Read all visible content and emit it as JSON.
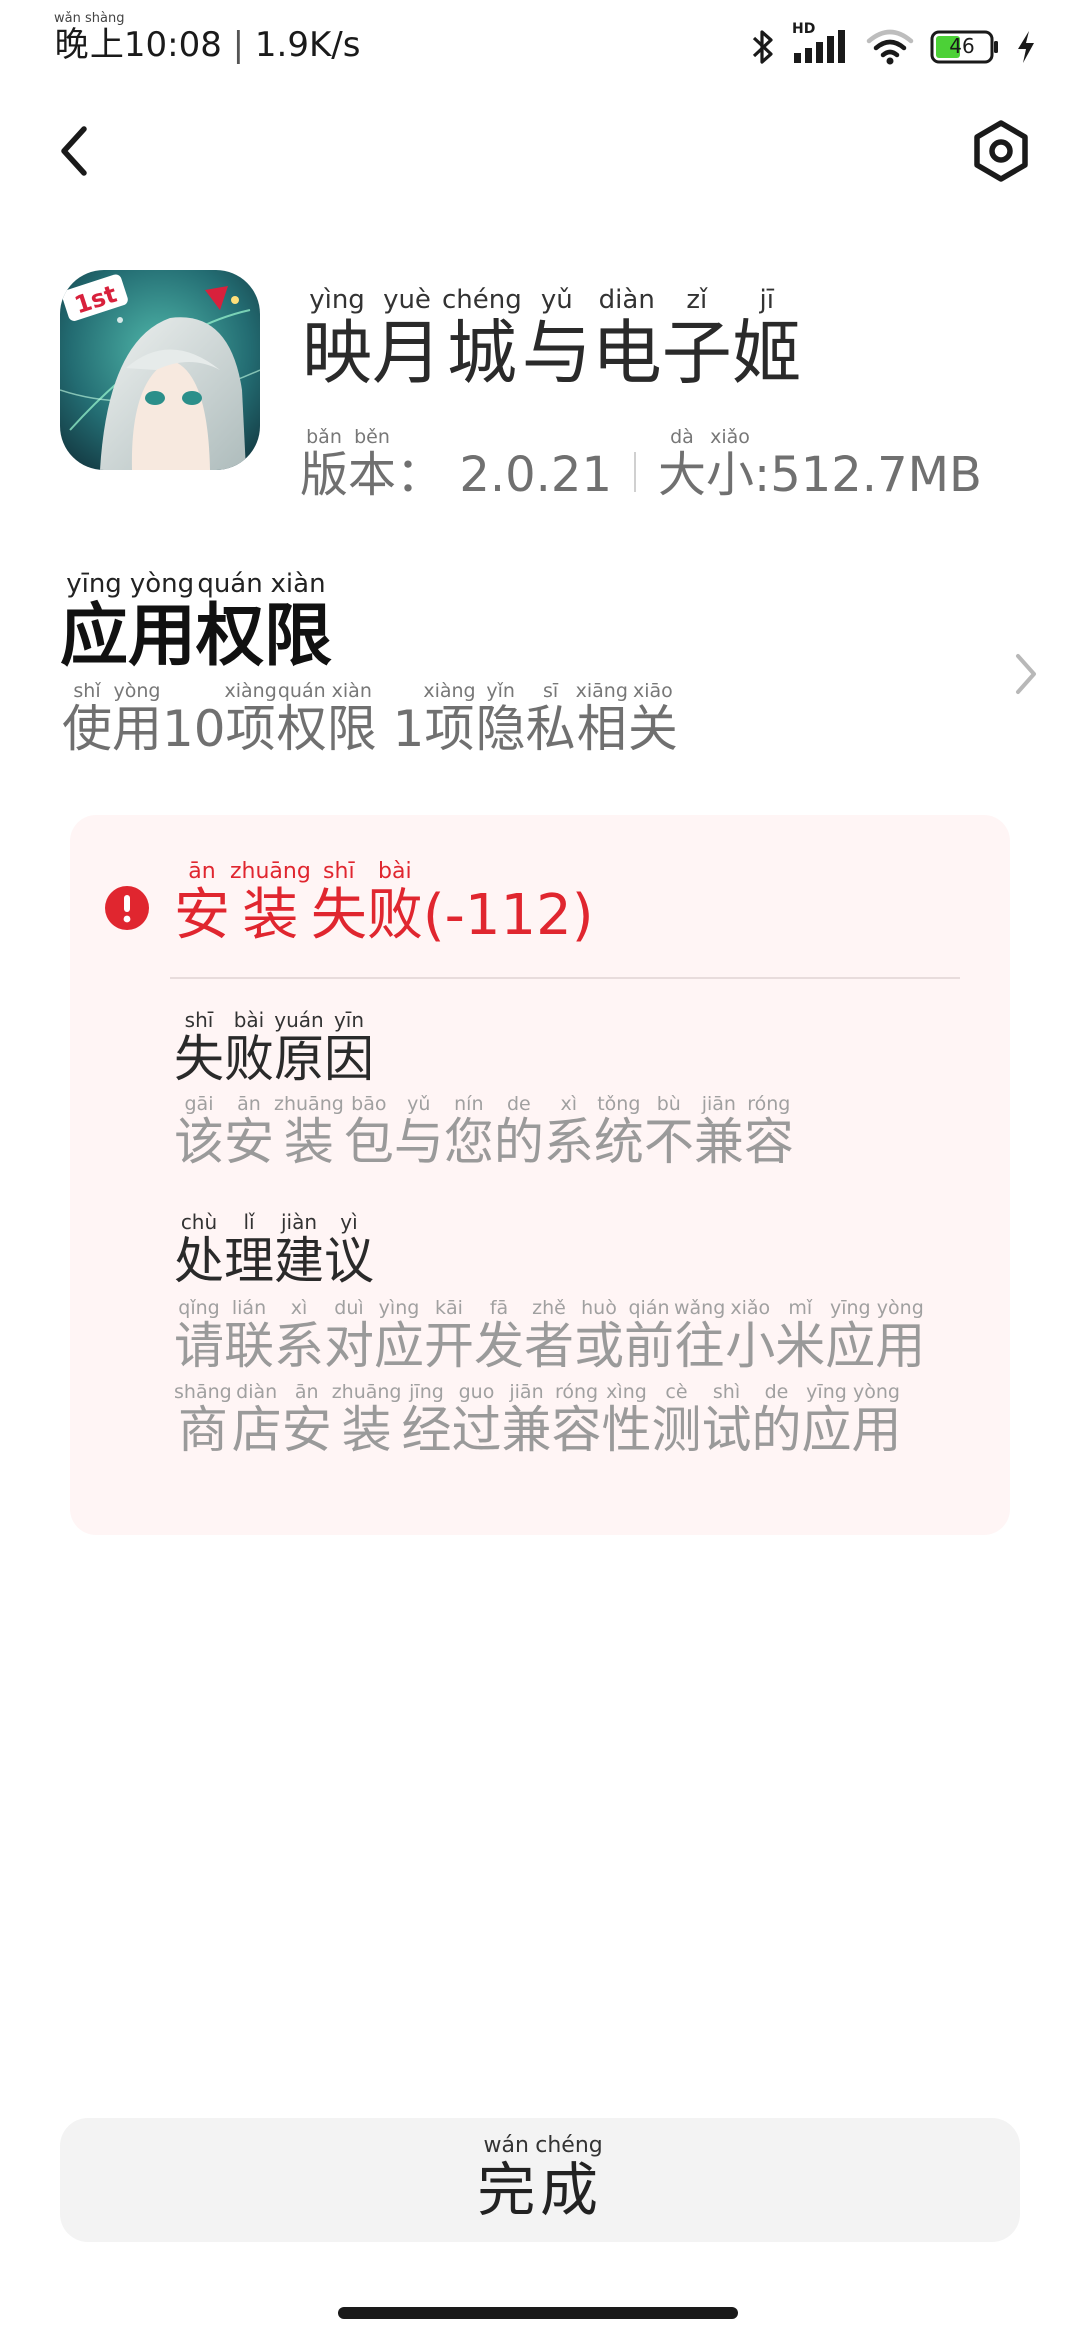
{
  "status_bar": {
    "time_prefix": "晚上",
    "time_prefix_pinyin": "wǎn shàng",
    "time": "10:08",
    "net_speed": "1.9K/s",
    "hd_label": "HD",
    "battery": "46",
    "icons": [
      "bluetooth-icon",
      "signal-icon",
      "wifi-icon",
      "battery-icon",
      "charging-icon"
    ]
  },
  "nav": {
    "back_icon": "chevron-left-icon",
    "settings_icon": "gear-icon"
  },
  "app": {
    "title": "映月城与电子姬",
    "title_pinyin": [
      "yìng",
      "yuè",
      "chéng",
      "yǔ",
      "diàn",
      "zǐ",
      "jī"
    ],
    "version_label": "版本",
    "version_label_pinyin": [
      "bǎn",
      "běn"
    ],
    "version_sep": "：",
    "version": "2.0.21",
    "size_label": "大小",
    "size_label_pinyin": [
      "dà",
      "xiǎo"
    ],
    "size_sep": ":",
    "size": "512.7MB"
  },
  "permissions": {
    "title": "应用权限",
    "title_pinyin": [
      "yīng",
      "yòng",
      "quán",
      "xiàn"
    ],
    "summary_parts": [
      {
        "t": "使",
        "p": "shǐ"
      },
      {
        "t": "用",
        "p": "yòng"
      },
      {
        "t": "10",
        "p": ""
      },
      {
        "t": "项",
        "p": "xiàng"
      },
      {
        "t": "权",
        "p": "quán"
      },
      {
        "t": "限",
        "p": "xiàn"
      },
      {
        "t": " ",
        "p": ""
      },
      {
        "t": "1",
        "p": ""
      },
      {
        "t": "项",
        "p": "xiàng"
      },
      {
        "t": "隐",
        "p": "yǐn"
      },
      {
        "t": "私",
        "p": "sī"
      },
      {
        "t": "相",
        "p": "xiāng"
      },
      {
        "t": "关",
        "p": "xiāo"
      }
    ],
    "chevron_icon": "chevron-right-icon"
  },
  "error": {
    "icon": "error-icon",
    "title": "安装失败",
    "title_pinyin": [
      "ān",
      "zhuāng",
      "shī",
      "bài"
    ],
    "code": "(-112)",
    "color": "#e0262f",
    "reason_label": "失败原因",
    "reason_label_pinyin": [
      "shī",
      "bài",
      "yuán",
      "yīn"
    ],
    "reason_text": "该安装包与您的系统不兼容",
    "reason_text_pinyin": [
      "gāi",
      "ān",
      "zhuāng",
      "bāo",
      "yǔ",
      "nín",
      "de",
      "xì",
      "tǒng",
      "bù",
      "jiān",
      "róng"
    ],
    "advice_label": "处理建议",
    "advice_label_pinyin": [
      "chù",
      "lǐ",
      "jiàn",
      "yì"
    ],
    "advice_line1": "请联系对应开发者或前往小米应用",
    "advice_line1_pinyin": [
      "qǐng",
      "lián",
      "xì",
      "duì",
      "yìng",
      "kāi",
      "fā",
      "zhě",
      "huò",
      "qián",
      "wǎng",
      "xiǎo",
      "mǐ",
      "yīng",
      "yòng"
    ],
    "advice_line2": "商店安装经过兼容性测试的应用",
    "advice_line2_pinyin": [
      "shāng",
      "diàn",
      "ān",
      "zhuāng",
      "jīng",
      "guo",
      "jiān",
      "róng",
      "xìng",
      "cè",
      "shì",
      "de",
      "yīng",
      "yòng"
    ]
  },
  "done_button": {
    "label": "完成",
    "label_pinyin": [
      "wán",
      "chéng"
    ]
  }
}
